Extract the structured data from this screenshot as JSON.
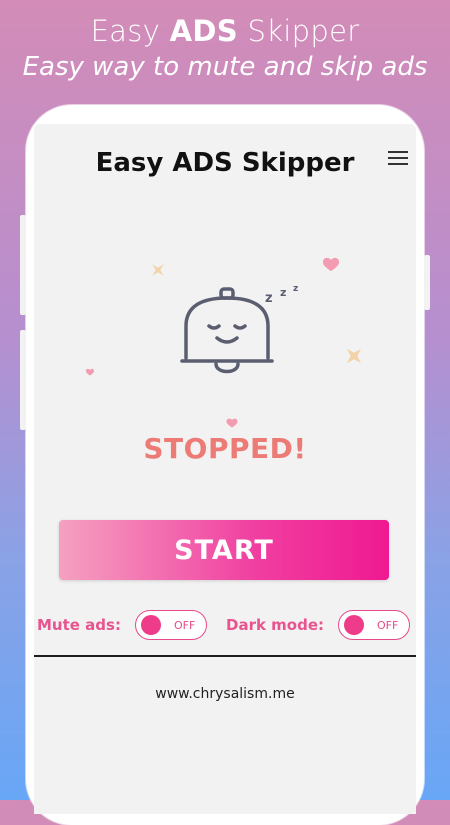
{
  "promo": {
    "title_prefix": "Easy ",
    "title_bold": "ADS",
    "title_suffix": " Skipper",
    "subtitle": "Easy way to mute and skip ads"
  },
  "app": {
    "title": "Easy ADS Skipper",
    "menu_icon": "hamburger-menu-icon"
  },
  "illustration": {
    "icon": "sleeping-bell-icon",
    "sleep_text": "Z Z Z"
  },
  "status": {
    "text": "STOPPED!",
    "color": "#ec7b76"
  },
  "start_button": {
    "label": "START"
  },
  "toggles": {
    "mute": {
      "label": "Mute ads:",
      "state": "OFF"
    },
    "dark": {
      "label": "Dark mode:",
      "state": "OFF"
    }
  },
  "footer": {
    "link": "www.chrysalism.me"
  },
  "colors": {
    "accent": "#ef1991",
    "toggle": "#e64a8a",
    "status": "#ec7b76"
  }
}
